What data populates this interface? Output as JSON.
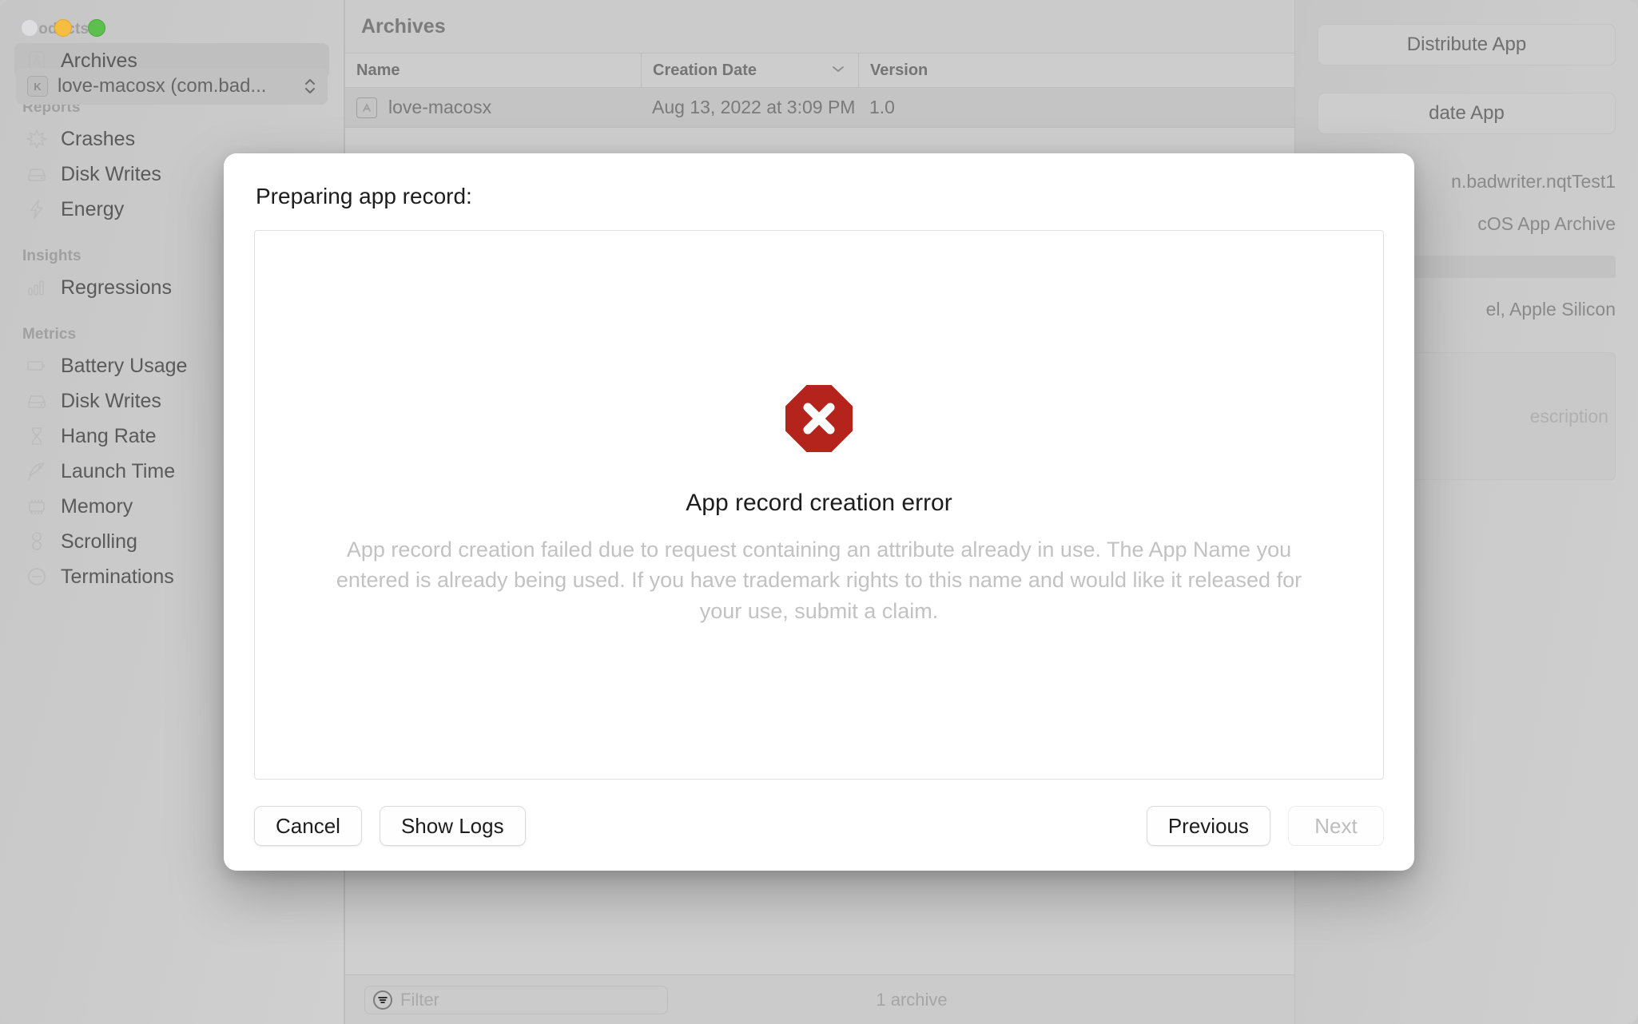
{
  "window": {
    "traffic_lights": [
      "close",
      "minimize",
      "zoom"
    ],
    "scheme_selector": {
      "icon": "app-scheme-icon",
      "label": "love-macosx (com.bad...",
      "chevron": "up-down-chevron-icon"
    }
  },
  "sidebar": {
    "sections": [
      {
        "title": "Products",
        "items": [
          {
            "label": "Archives",
            "icon": "archive-app-icon",
            "selected": true
          }
        ]
      },
      {
        "title": "Reports",
        "items": [
          {
            "label": "Crashes",
            "icon": "crash-star-icon",
            "selected": false
          },
          {
            "label": "Disk Writes",
            "icon": "disk-icon",
            "selected": false
          },
          {
            "label": "Energy",
            "icon": "bolt-icon",
            "selected": false
          }
        ]
      },
      {
        "title": "Insights",
        "items": [
          {
            "label": "Regressions",
            "icon": "bar-chart-icon",
            "selected": false
          }
        ]
      },
      {
        "title": "Metrics",
        "items": [
          {
            "label": "Battery Usage",
            "icon": "battery-icon",
            "selected": false
          },
          {
            "label": "Disk Writes",
            "icon": "disk-icon",
            "selected": false
          },
          {
            "label": "Hang Rate",
            "icon": "hourglass-icon",
            "selected": false
          },
          {
            "label": "Launch Time",
            "icon": "rocket-icon",
            "selected": false
          },
          {
            "label": "Memory",
            "icon": "memory-chip-icon",
            "selected": false
          },
          {
            "label": "Scrolling",
            "icon": "scroll-icon",
            "selected": false
          },
          {
            "label": "Terminations",
            "icon": "minus-circle-icon",
            "selected": false
          }
        ]
      }
    ]
  },
  "main": {
    "title": "Archives",
    "columns": [
      "Name",
      "Creation Date",
      "Version"
    ],
    "sort_indicator": "chevron-down-icon",
    "rows": [
      {
        "name": "love-macosx",
        "date": "Aug 13, 2022 at 3:09 PM",
        "version": "1.0",
        "icon": "archive-app-icon"
      }
    ],
    "footer": {
      "filter_placeholder": "Filter",
      "filter_icon": "filter-icon",
      "count_label": "1 archive"
    }
  },
  "inspector": {
    "buttons": [
      {
        "label": "Distribute App"
      },
      {
        "label": "date App"
      }
    ],
    "details": [
      "n.badwriter.nqtTest1",
      "cOS App Archive",
      "el, Apple Silicon"
    ],
    "description_placeholder": "escription"
  },
  "sheet": {
    "title": "Preparing app record:",
    "error_icon": "error-octagon-x-icon",
    "error_color": "#b5241c",
    "error_title": "App record creation error",
    "error_message": "App record creation failed due to request containing an attribute already in use. The App Name you entered is already being used. If you have trademark rights to this name and would like it released for your use, submit a claim.",
    "buttons": {
      "cancel": "Cancel",
      "show_logs": "Show Logs",
      "previous": "Previous",
      "next": "Next"
    }
  }
}
